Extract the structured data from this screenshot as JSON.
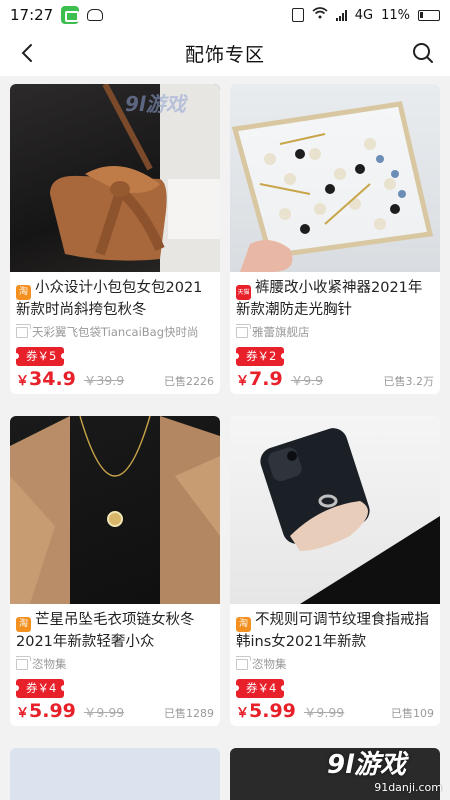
{
  "status_bar": {
    "time": "17:27",
    "network": "4G",
    "battery": "11%"
  },
  "nav": {
    "title": "配饰专区"
  },
  "watermark": {
    "top_mark": "9l游戏",
    "corner_mark": "9l游戏",
    "corner_domain": "91danji.com"
  },
  "products": [
    {
      "badge": "淘",
      "badge_color": "#f39020",
      "title": "小众设计小包包女包2021新款时尚斜挎包秋冬",
      "shop": "天彩翼飞包袋TiancaiBag快时尚",
      "coupon": "券￥5",
      "currency": "￥",
      "price": "34.9",
      "original_price": "￥39.9",
      "sold": "已售2226"
    },
    {
      "badge": "天猫",
      "badge_color": "#e8202a",
      "title": "裤腰改小收紧神器2021年新款潮防走光胸针",
      "shop": "雅蕾旗舰店",
      "coupon": "券￥2",
      "currency": "￥",
      "price": "7.9",
      "original_price": "￥9.9",
      "sold": "已售3.2万"
    },
    {
      "badge": "淘",
      "badge_color": "#f39020",
      "title": "芒星吊坠毛衣项链女秋冬2021年新款轻奢小众",
      "shop": "恣物集",
      "coupon": "券￥4",
      "currency": "￥",
      "price": "5.99",
      "original_price": "￥9.99",
      "sold": "已售1289"
    },
    {
      "badge": "淘",
      "badge_color": "#f39020",
      "title": "不规则可调节纹理食指戒指韩ins女2021年新款",
      "shop": "恣物集",
      "coupon": "券￥4",
      "currency": "￥",
      "price": "5.99",
      "original_price": "￥9.99",
      "sold": "已售109"
    }
  ]
}
